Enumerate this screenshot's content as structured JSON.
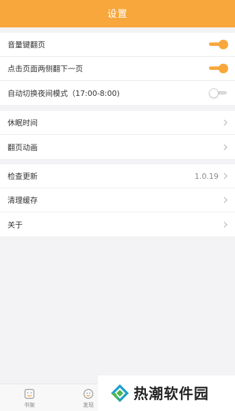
{
  "header": {
    "title": "设置"
  },
  "groups": {
    "reading": [
      {
        "label": "音量键翻页",
        "toggle": "on"
      },
      {
        "label": "点击页面两侧翻下一页",
        "toggle": "on"
      },
      {
        "label": "自动切换夜间模式（17:00-8:00)",
        "toggle": "off"
      }
    ],
    "display": [
      {
        "label": "休眠时间"
      },
      {
        "label": "翻页动画"
      }
    ],
    "about": [
      {
        "label": "检查更新",
        "value": "1.0.19"
      },
      {
        "label": "清理缓存"
      },
      {
        "label": "关于"
      }
    ]
  },
  "bottom_nav": {
    "tabs": [
      {
        "label": "书架",
        "icon": "bookshelf-icon"
      },
      {
        "label": "发现",
        "icon": "discover-icon"
      }
    ]
  },
  "watermark": {
    "text": "热潮软件园"
  },
  "colors": {
    "accent": "#f7a73c",
    "background": "#f3f3f5",
    "text": "#333333",
    "muted": "#888888"
  }
}
